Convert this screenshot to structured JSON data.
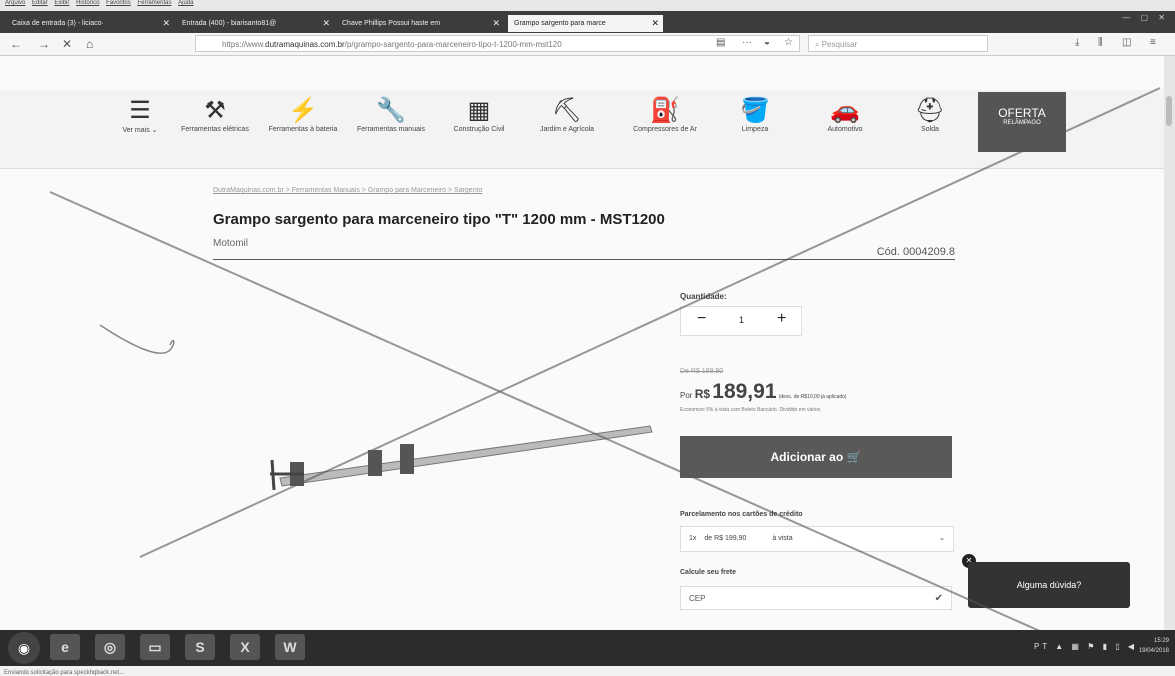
{
  "menubar": {
    "items": [
      "Arquivo",
      "Editar",
      "Exibir",
      "Histórico",
      "Favoritos",
      "Ferramentas",
      "Ajuda"
    ]
  },
  "tabs": [
    {
      "label": "Caixa de entrada (3) - liciaco·"
    },
    {
      "label": "Entrada (400) - biarisanto81@"
    },
    {
      "label": "Chave Phillips Possui haste em"
    },
    {
      "label": "Grampo sargento para marce"
    }
  ],
  "url": {
    "prefix": "https://www.",
    "domain": "dutramaquinas.com.br",
    "path": "/p/grampo-sargento-para-marceneiro-tipo-t-1200-mm-mst120"
  },
  "search": {
    "placeholder": "Pesquisar"
  },
  "categories": [
    {
      "icon": "drill-icon",
      "label": "Ferramentas elétricas"
    },
    {
      "icon": "cordless-drill-icon",
      "label": "Ferramentas à bateria"
    },
    {
      "icon": "hand-tools-icon",
      "label": "Ferramentas manuais"
    },
    {
      "icon": "bricks-icon",
      "label": "Construção Civil"
    },
    {
      "icon": "lawnmower-icon",
      "label": "Jardim e Agrícola"
    },
    {
      "icon": "compressor-icon",
      "label": "Compressores de Ar"
    },
    {
      "icon": "bucket-icon",
      "label": "Limpeza"
    },
    {
      "icon": "car-icon",
      "label": "Automotivo"
    },
    {
      "icon": "welding-mask-icon",
      "label": "Solda"
    }
  ],
  "vermais": "Ver mais",
  "offer": {
    "line1": "OFERTA",
    "line2": "RELÂMPAGO"
  },
  "breadcrumb": "DutraMaquinas.com.br > Ferramentas Manuais > Grampo para Marceneiro > Sargento",
  "product": {
    "title": "Grampo sargento para marceneiro tipo \"T\" 1200 mm - MST1200",
    "brand": "Motomil",
    "code": "Cód. 0004209.8",
    "qty_label": "Quantidade:",
    "qty_value": "1",
    "old_price": "De R$ 199,90",
    "price_prefix": "Por",
    "price_currency": "R$",
    "price_value": "189,91",
    "price_note": "(desc. de R$10,00 já aplicado)",
    "saving": "Economize 5% à vista com Boleto Bancário. Dividido em vários",
    "add_button": "Adicionar ao",
    "parc_label": "Parcelamento nos cartões de crédito",
    "parc_installments": "1x",
    "parc_value": "de R$ 199,90",
    "parc_mode": "à vista",
    "frete_label": "Calcule seu frete",
    "cep_placeholder": "CEP"
  },
  "chat": {
    "label": "Alguma dúvida?"
  },
  "status": "Enviando solicitação para speckhqback.net...",
  "clock": {
    "time": "15:29",
    "date": "19/04/2018"
  }
}
